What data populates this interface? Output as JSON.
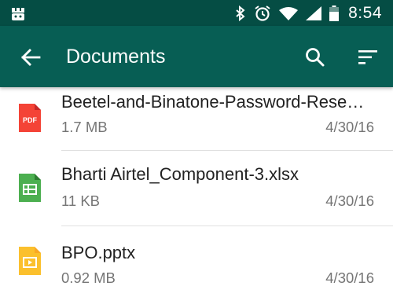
{
  "status_bar": {
    "time": "8:54",
    "icons": [
      "android-notification-icon",
      "bluetooth-icon",
      "alarm-icon",
      "wifi-icon",
      "signal-icon",
      "battery-icon"
    ]
  },
  "app_bar": {
    "title": "Documents",
    "background": "#075e54",
    "status_background": "#054d44",
    "icons": [
      "back-arrow-icon",
      "search-icon",
      "sort-icon"
    ]
  },
  "files": [
    {
      "name": "Beetel-and-Binatone-Password-Reset-Procedure.pdf",
      "display_name": "Beetel-and-Binatone-Password-Rese…",
      "size": "1.7 MB",
      "date": "4/30/16",
      "icon": "pdf-icon",
      "icon_label": "PDF",
      "color": "#f44336"
    },
    {
      "name": "Bharti Airtel_Component-3.xlsx",
      "display_name": "Bharti Airtel_Component-3.xlsx",
      "size": "11 KB",
      "date": "4/30/16",
      "icon": "spreadsheet-icon",
      "color": "#4caf50"
    },
    {
      "name": "BPO.pptx",
      "display_name": "BPO.pptx",
      "size": "0.92 MB",
      "date": "4/30/16",
      "icon": "presentation-icon",
      "color": "#fbc02d"
    }
  ]
}
